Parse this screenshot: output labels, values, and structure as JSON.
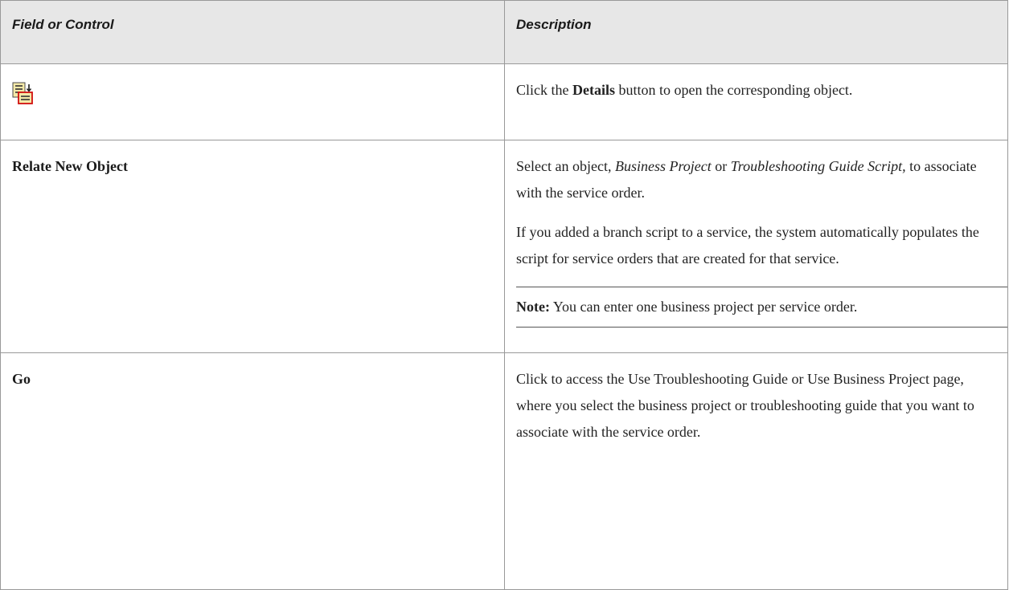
{
  "table": {
    "headers": {
      "field": "Field or Control",
      "description": "Description"
    },
    "rows": [
      {
        "field_icon": "details-icon",
        "desc_prefix": "Click the ",
        "desc_bold": "Details",
        "desc_suffix": " button to open the corresponding object."
      },
      {
        "field": "Relate New Object",
        "desc_p1_a": "Select an object, ",
        "desc_p1_i1": "Business Project",
        "desc_p1_b": " or ",
        "desc_p1_i2": "Troubleshooting Guide Script,",
        "desc_p1_c": " to associate with the service order.",
        "desc_p2": "If you added a branch script to a service, the system automatically populates the script for service orders that are created for that service.",
        "note_label": "Note:",
        "note_text": " You can enter one business project per service order."
      },
      {
        "field": "Go",
        "desc": "Click to access the Use Troubleshooting Guide or Use Business Project page, where you select the business project or troubleshooting guide that you want to associate with the service order."
      }
    ]
  }
}
